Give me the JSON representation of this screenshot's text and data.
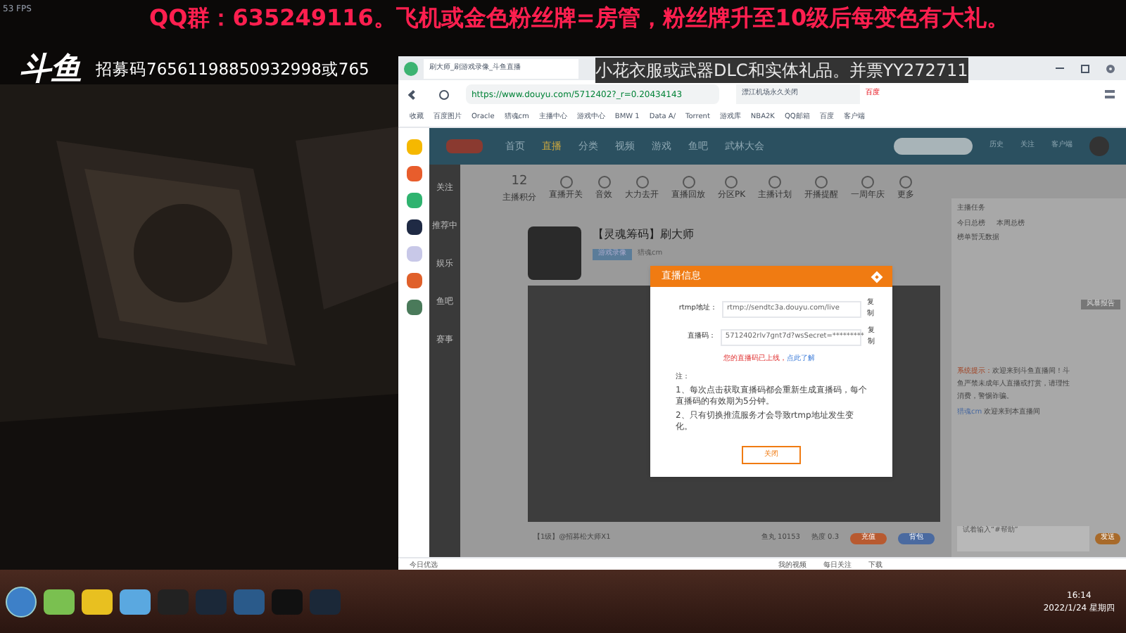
{
  "stream_overlay": {
    "fps": "53 FPS",
    "banner": "QQ群：635249116。飞机或金色粉丝牌=房管，粉丝牌升至10级后每变色有大礼。",
    "logo": "斗鱼",
    "recruit": "招募码76561198850932998或765",
    "scroll_text": "小花衣服或武器DLC和实体礼品。并票YY272711"
  },
  "browser": {
    "tab_title": "刷大师_刷游戏录像_斗鱼直播",
    "url": "https://www.douyu.com/5712402?_r=0.20434143",
    "search": "漂江机场永久关闭",
    "search_button": "百度",
    "bookmarks": [
      "收藏",
      "百度图片",
      "Oracle",
      "猎魂cm",
      "主播中心",
      "游戏中心",
      "BMW 1",
      "Data A/",
      "Torrent",
      "游戏库",
      "NBA2K",
      "QQ邮箱",
      "百度",
      "客户端"
    ],
    "status_bar": [
      "今日优选",
      "我的视频",
      "每日关注",
      "下载"
    ]
  },
  "site": {
    "nav": [
      {
        "label": "首页",
        "selected": false
      },
      {
        "label": "直播",
        "selected": true
      },
      {
        "label": "分类",
        "selected": false
      },
      {
        "label": "视频",
        "selected": false
      },
      {
        "label": "游戏",
        "selected": false
      },
      {
        "label": "鱼吧",
        "selected": false
      },
      {
        "label": "武林大会",
        "selected": false
      }
    ],
    "header_icons": [
      "历史",
      "关注",
      "客户端"
    ],
    "side_nav": [
      "关注",
      "推荐中",
      "娱乐",
      "鱼吧",
      "赛事"
    ],
    "tools": [
      {
        "label": "主播积分",
        "value": "12"
      },
      {
        "label": "直播开关"
      },
      {
        "label": "音效"
      },
      {
        "label": "大力去开"
      },
      {
        "label": "直播回放"
      },
      {
        "label": "分区PK"
      },
      {
        "label": "主播计划"
      },
      {
        "label": "开播提醒"
      },
      {
        "label": "一周年庆"
      },
      {
        "label": "更多"
      }
    ],
    "room_title": "【灵魂筹码】刷大师",
    "room_tag": "游戏录像",
    "room_category": "猎魂cm",
    "chat": {
      "task": "主播任务",
      "tabs": [
        "今日总榜",
        "本周总榜"
      ],
      "notice": "榜单暂无数据",
      "system_label": "系统提示：",
      "system_text": "欢迎来到斗鱼直播间！斗鱼严禁未成年人直播或打赏，请理性消费，警惕诈骗。",
      "welcome_user": "猎魂cm",
      "welcome_text": "欢迎来到本直播间",
      "input_placeholder": "试着输入“#帮助”",
      "send": "发送",
      "popup": "风暴报告"
    },
    "bottom": {
      "fans": "鱼丸 10153",
      "hot": "热度 0.3",
      "buttons": [
        "充值",
        "背包"
      ],
      "bullet": "【1级】@招募松大师X1"
    }
  },
  "dialog": {
    "title": "直播信息",
    "rows": [
      {
        "label": "rtmp地址：",
        "value": "rtmp://sendtc3a.douyu.com/live",
        "copy": "复制"
      },
      {
        "label": "直播码：",
        "value": "5712402rlv7gnt7d?wsSecret=*********",
        "copy": "复制"
      }
    ],
    "warning": "您的直播码已上线，",
    "warning_link": "点此了解",
    "note_title": "注：",
    "notes": [
      "1、每次点击获取直播码都会重新生成直播码，每个直播码的有效期为5分钟。",
      "2、只有切换推流服务才会导致rtmp地址发生变化。"
    ],
    "close": "关闭"
  },
  "taskbar": {
    "time": "16:14",
    "date": "2022/1/24 星期四"
  }
}
